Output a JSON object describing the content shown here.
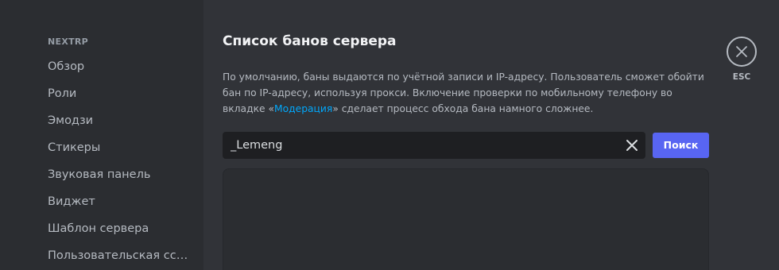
{
  "sidebar": {
    "header": "NEXTRP",
    "items": [
      {
        "label": "Обзор"
      },
      {
        "label": "Роли"
      },
      {
        "label": "Эмодзи"
      },
      {
        "label": "Стикеры"
      },
      {
        "label": "Звуковая панель"
      },
      {
        "label": "Виджет"
      },
      {
        "label": "Шаблон сервера"
      },
      {
        "label": "Пользовательская ссылка"
      }
    ]
  },
  "main": {
    "title": "Список банов сервера",
    "description": {
      "text_before": "По умолчанию, баны выдаются по учётной записи и IP-адресу. Пользователь сможет обойти бан по IP-адресу, используя прокси. Включение проверки по мобильному телефону во вкладке «",
      "link": "Модерация",
      "text_after": "» сделает процесс обхода бана намного сложнее."
    },
    "search": {
      "value": "_Lemeng",
      "button_label": "Поиск"
    }
  },
  "close": {
    "label": "ESC"
  },
  "icons": {
    "clear": "close-icon",
    "close": "close-icon"
  },
  "colors": {
    "background": "#313338",
    "sidebar": "#2b2d31",
    "input": "#1e1f22",
    "accent": "#5865f2",
    "link": "#00a8fc"
  }
}
